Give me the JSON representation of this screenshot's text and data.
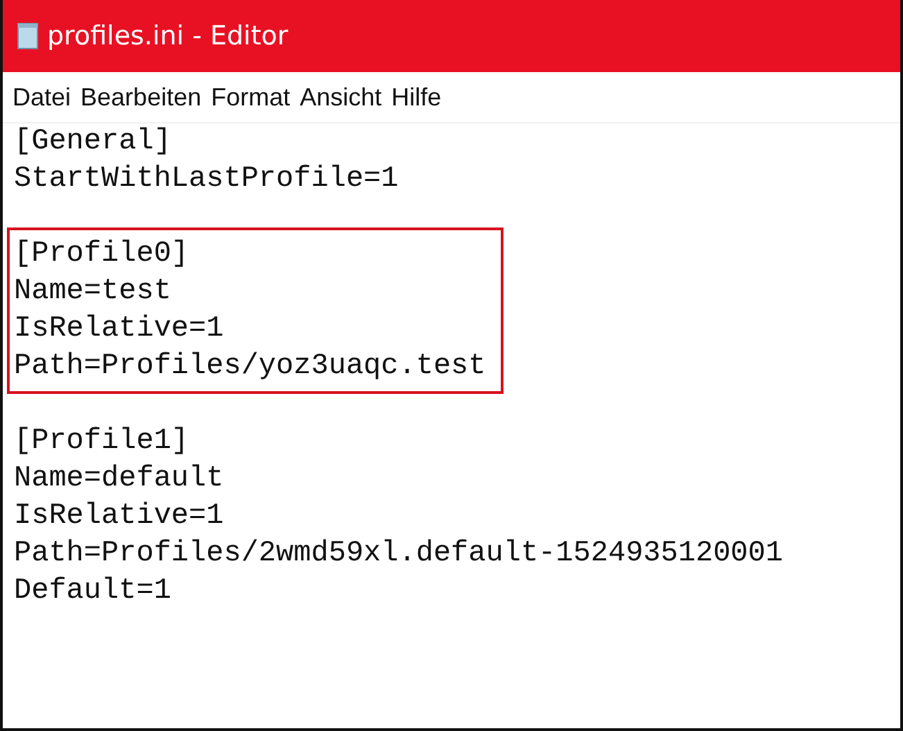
{
  "window": {
    "title": "profiles.ini - Editor"
  },
  "menu": [
    "Datei",
    "Bearbeiten",
    "Format",
    "Ansicht",
    "Hilfe"
  ],
  "blocks": [
    {
      "highlighted": false,
      "lines": [
        "[General]",
        "StartWithLastProfile=1"
      ]
    },
    {
      "highlighted": true,
      "lines": [
        "[Profile0]",
        "Name=test",
        "IsRelative=1",
        "Path=Profiles/yoz3uaqc.test"
      ]
    },
    {
      "highlighted": false,
      "lines": [
        "[Profile1]",
        "Name=default",
        "IsRelative=1",
        "Path=Profiles/2wmd59xl.default-1524935120001",
        "Default=1"
      ]
    }
  ]
}
